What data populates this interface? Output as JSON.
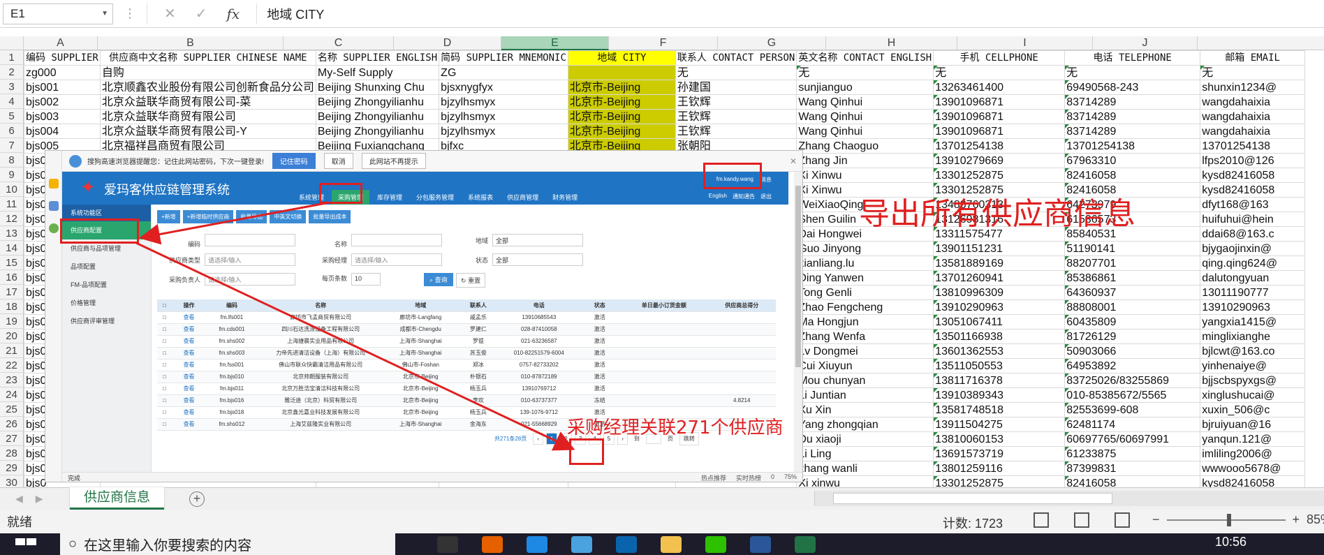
{
  "formula_bar": {
    "name_box": "E1",
    "formula": "地域 CITY"
  },
  "columns": [
    "A",
    "B",
    "C",
    "D",
    "E",
    "F",
    "G",
    "H",
    "I",
    "J"
  ],
  "rows": [
    [
      "编码 SUPPLIER",
      "供应商中文名称 SUPPLIER CHINESE NAME",
      "名称 SUPPLIER ENGLISH",
      "简码 SUPPLIER MNEMONIC",
      "地域 CITY",
      "联系人 CONTACT PERSON",
      "英文名称 CONTACT ENGLISH",
      "手机 CELLPHONE",
      "电话 TELEPHONE",
      "邮箱 EMAIL"
    ],
    [
      "zg000",
      "自购",
      "My-Self Supply",
      "ZG",
      "",
      "无",
      "无",
      "无",
      "无",
      "无"
    ],
    [
      "bjs001",
      "北京顺鑫农业股份有限公司创新食品分公司",
      "Beijing Shunxing Chu",
      "bjsxnygfyx",
      "北京市-Beijing",
      "孙建国",
      "sunjianguo",
      "13263461400",
      "69490568-243",
      "shunxin1234@"
    ],
    [
      "bjs002",
      "北京众益联华商贸有限公司-菜",
      "Beijing Zhongyilianhu",
      "bjzylhsmyx",
      "北京市-Beijing",
      "王钦辉",
      "Wang Qinhui",
      "13901096871",
      "83714289",
      "wangdahaixia"
    ],
    [
      "bjs003",
      "北京众益联华商贸有限公司",
      "Beijing Zhongyilianhu",
      "bjzylhsmyx",
      "北京市-Beijing",
      "王钦辉",
      "Wang Qinhui",
      "13901096871",
      "83714289",
      "wangdahaixia"
    ],
    [
      "bjs004",
      "北京众益联华商贸有限公司-Y",
      "Beijing Zhongyilianhu",
      "bjzylhsmyx",
      "北京市-Beijing",
      "王钦辉",
      "Wang Qinhui",
      "13901096871",
      "83714289",
      "wangdahaixia"
    ],
    [
      "bjs005",
      "北京福祥昌商贸有限公司",
      "Beijing Fuxiangchang",
      "bjfxc",
      "北京市-Beijing",
      "张朝阳",
      "Zhang Chaoguo",
      "13701254138",
      "13701254138",
      "13701254138"
    ],
    [
      "bjs0",
      "",
      "",
      "",
      "",
      "",
      "Zhang Jin",
      "13910279669",
      "67963310",
      "lfps2010@126"
    ],
    [
      "bjs0",
      "",
      "",
      "",
      "",
      "",
      "Xi Xinwu",
      "13301252875",
      "82416058",
      "kysd82416058"
    ],
    [
      "bjs0",
      "",
      "",
      "",
      "",
      "",
      "Xi Xinwu",
      "13301252875",
      "82416058",
      "kysd82416058"
    ],
    [
      "bjs0",
      "",
      "",
      "",
      "",
      "",
      "WeiXiaoQing",
      "13488760313",
      "64273979",
      "dfyt168@163"
    ],
    [
      "bjs0",
      "",
      "",
      "",
      "",
      "",
      "Shen Guilin",
      "13126981316",
      "61536573",
      "huifuhui@hein"
    ],
    [
      "bjs0",
      "",
      "",
      "",
      "",
      "",
      "Dai Hongwei",
      "13311575477",
      "85840531",
      "ddai68@163.c"
    ],
    [
      "bjs0",
      "",
      "",
      "",
      "",
      "",
      "Guo Jinyong",
      "13901151231",
      "51190141",
      "bjygaojinxin@"
    ],
    [
      "bjs0",
      "",
      "",
      "",
      "",
      "",
      "xianliang.lu",
      "13581889169",
      "88207701",
      "qing.qing624@"
    ],
    [
      "bjs0",
      "",
      "",
      "",
      "",
      "",
      "Ding Yanwen",
      "13701260941",
      "85386861",
      "dalutongyuan"
    ],
    [
      "bjs0",
      "",
      "",
      "",
      "",
      "",
      "Tong Genli",
      "13810996309",
      "64360937",
      "13011190777"
    ],
    [
      "bjs0",
      "",
      "",
      "",
      "",
      "",
      "Zhao Fengcheng",
      "13910290963",
      "88808001",
      "13910290963"
    ],
    [
      "bjs0",
      "",
      "",
      "",
      "",
      "",
      "Ma Hongjun",
      "13051067411",
      "60435809",
      "yangxia1415@"
    ],
    [
      "bjs0",
      "",
      "",
      "",
      "",
      "",
      "Zhang Wenfa",
      "13501166938",
      "81726129",
      "minglixianghe"
    ],
    [
      "bjs0",
      "",
      "",
      "",
      "",
      "",
      "Lv Dongmei",
      "13601362553",
      "50903066",
      "bjlcwt@163.co"
    ],
    [
      "bjs0",
      "",
      "",
      "",
      "",
      "",
      "Cui Xiuyun",
      "13511050553",
      "64953892",
      "yinhenaiye@"
    ],
    [
      "bjs0",
      "",
      "",
      "",
      "",
      "",
      "Mou chunyan",
      "13811716378",
      "83725026/83255869",
      "bjjscbspyxgs@"
    ],
    [
      "bjs0",
      "",
      "",
      "",
      "",
      "",
      "Li Juntian",
      "13910389343",
      "010-85385672/5565",
      "xinglushucai@"
    ],
    [
      "bjs0",
      "",
      "",
      "",
      "",
      "",
      "Xu Xin",
      "13581748518",
      "82553699-608",
      "xuxin_506@c"
    ],
    [
      "bjs0",
      "",
      "",
      "",
      "",
      "",
      "Yang zhongqian",
      "13911504275",
      "62481174",
      "bjruiyuan@16"
    ],
    [
      "bjs0",
      "",
      "",
      "",
      "",
      "",
      "Du xiaoji",
      "13810060153",
      "60697765/60697991",
      "yanqun.121@"
    ],
    [
      "bjs0",
      "",
      "",
      "",
      "",
      "",
      "Li Ling",
      "13691573719",
      "61233875",
      "imliling2006@"
    ],
    [
      "bjs0",
      "",
      "",
      "",
      "",
      "",
      "zhang wanli",
      "13801259116",
      "87399831",
      "wwwooo5678@"
    ],
    [
      "bjs0",
      "",
      "",
      "",
      "",
      "",
      "Xi xinwu",
      "13301252875",
      "82416058",
      "kysd82416058"
    ]
  ],
  "sheet_tab": "供应商信息",
  "status": {
    "ready": "就绪",
    "count": "计数: 1723",
    "zoom": "85%"
  },
  "taskbar": {
    "search_placeholder": "在这里输入你要搜索的内容",
    "time": "10:56"
  },
  "annotations": {
    "export_all": "导出所有供应商信息",
    "linked": "采购经理关联271个供应商"
  },
  "embedded": {
    "pw_prompt": "搜狗高速浏览器提醒您：记住此网站密码，下次一键登录!",
    "pw_remember": "记住密码",
    "pw_cancel": "取消",
    "pw_never": "此网站不再提示",
    "app_title": "爱玛客供应链管理系统",
    "nav": [
      "系统管理",
      "采购管理",
      "库存管理",
      "分包服务管理",
      "系统报表",
      "供应商管理",
      "财务管理"
    ],
    "user": "fm.kandy.wang",
    "msg": "消息",
    "links": [
      "English",
      "通知通告",
      "退出"
    ],
    "side_header": "系统功能区",
    "side_items": [
      "供应商配置",
      "供应商与品项管理",
      "品项配置",
      "FM-品项配置",
      "价格管理",
      "供应商评审管理"
    ],
    "toolbar": [
      "+新增",
      "+新增临时供应商",
      "批量导出",
      "中英文切换",
      "批量导出成本"
    ],
    "filters": {
      "code": "编码",
      "name": "名称",
      "region": "地域",
      "region_val": "全部",
      "type": "供应商类型",
      "type_ph": "请选择/输入",
      "manager": "采购经理",
      "manager_ph": "请选择/输入",
      "state": "状态",
      "state_val": "全部",
      "owner": "采购负责人",
      "owner_ph": "请选择/输入",
      "per_page": "每页条数",
      "per_page_val": "10",
      "query": "查询",
      "reset": "重置"
    },
    "table_headers": [
      "",
      "操作",
      "编码",
      "名称",
      "地域",
      "联系人",
      "电话",
      "状态",
      "单日最小订货金额",
      "供应商总得分"
    ],
    "table_rows": [
      [
        "",
        "查看",
        "fm.lfs001",
        "廊坊市飞孟商贸有限公司",
        "廊坊市-Langfang",
        "戚孟乐",
        "13910685543",
        "激活",
        "",
        ""
      ],
      [
        "",
        "查看",
        "fm.cds001",
        "四川石达洗涤设备工程有限公司",
        "成都市-Chengdu",
        "罗建仁",
        "028-87410058",
        "激活",
        "",
        ""
      ],
      [
        "",
        "查看",
        "fm.shs002",
        "上海捷晨实业用品有限公司",
        "上海市-Shanghai",
        "罗锟",
        "021-63236587",
        "激活",
        "",
        ""
      ],
      [
        "",
        "查看",
        "fm.shs003",
        "力帝先进清洁设备（上海）有限公司",
        "上海市-Shanghai",
        "苏玉俊",
        "010-82251579-6004",
        "激活",
        "",
        ""
      ],
      [
        "",
        "查看",
        "fm.fss001",
        "佛山市联众快霸清洁用品有限公司",
        "佛山市-Foshan",
        "郑冰",
        "0757-82733202",
        "激活",
        "",
        ""
      ],
      [
        "",
        "查看",
        "fm.bjs010",
        "北京帅朗服装有限公司",
        "北京市-Beijing",
        "朴银石",
        "010-87872189",
        "激活",
        "",
        ""
      ],
      [
        "",
        "查看",
        "fm.bjs011",
        "北京万胜浩宝清洁科技有限公司",
        "北京市-Beijing",
        "杨玉兵",
        "13910769712",
        "激活",
        "",
        ""
      ],
      [
        "",
        "查看",
        "fm.bjs016",
        "雅泛迪（北京）科贸有限公司",
        "北京市-Beijing",
        "李欢",
        "010-63737377",
        "冻结",
        "",
        "4.8214"
      ],
      [
        "",
        "查看",
        "fm.bjs018",
        "北京鑫光嘉业科技发展有限公司",
        "北京市-Beijing",
        "杨玉兵",
        "139-1076-9712",
        "激活",
        "",
        ""
      ],
      [
        "",
        "查看",
        "fm.shs012",
        "上海艾兹隆实业有限公司",
        "上海市-Shanghai",
        "金海东",
        "021-55668929",
        "激活",
        "",
        ""
      ]
    ],
    "pager": {
      "total": "共271条28页",
      "pages": [
        "‹",
        "1",
        "2",
        "3",
        "4",
        "5",
        "›"
      ],
      "goto": "到",
      "page_unit": "页",
      "jump": "跳转"
    },
    "status_left": "完成",
    "status_right": [
      "热点推荐",
      "实时热榜",
      "0",
      "75%"
    ]
  }
}
